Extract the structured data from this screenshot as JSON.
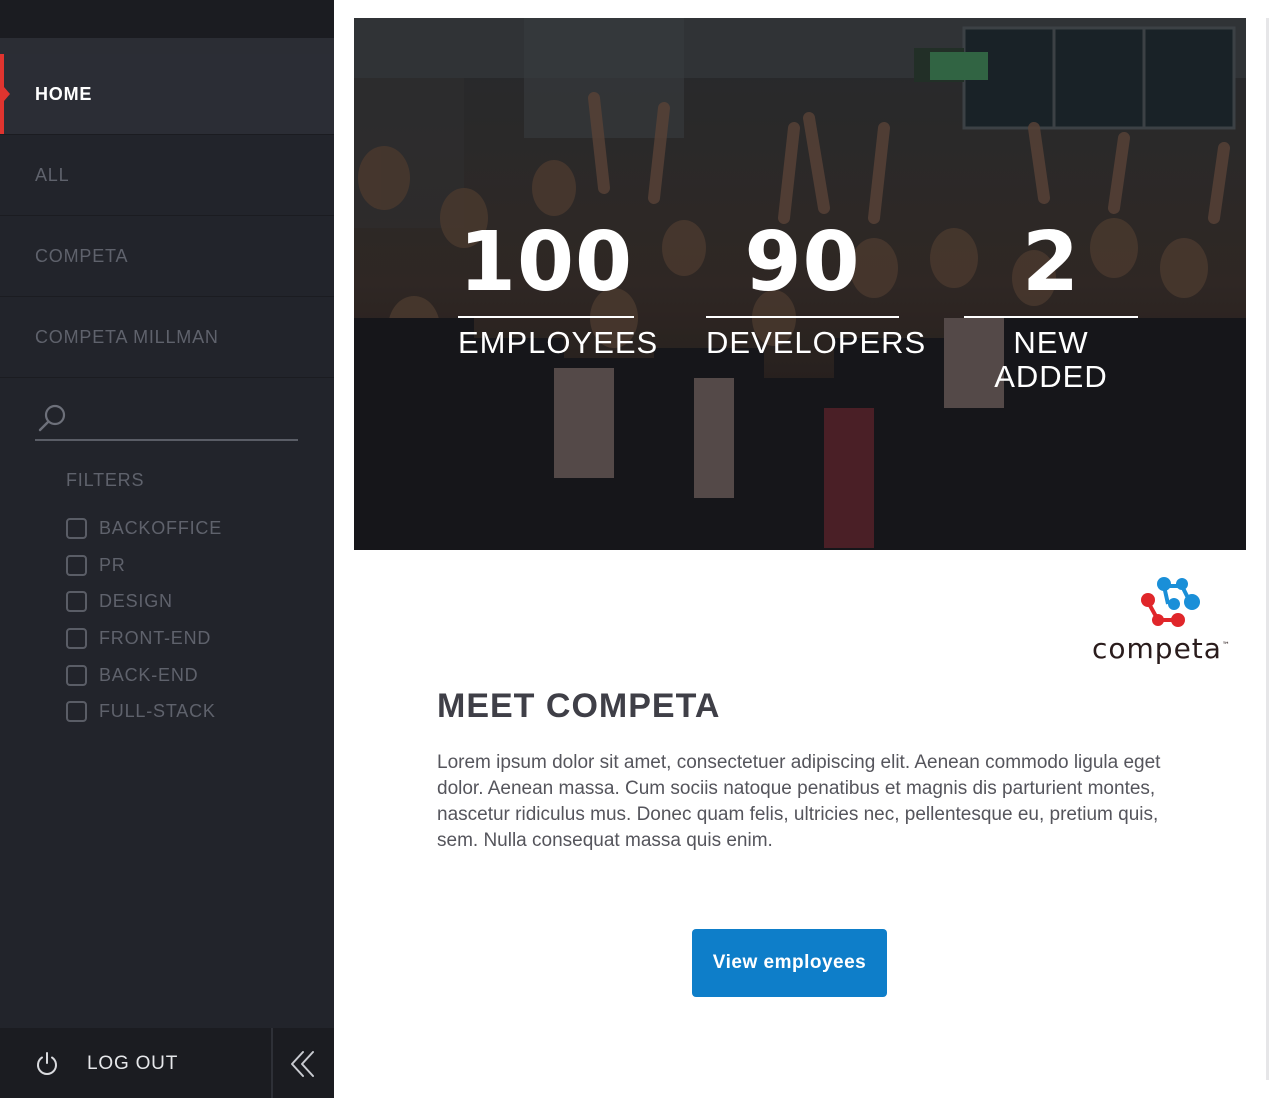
{
  "sidebar": {
    "nav": [
      {
        "label": "HOME",
        "active": true
      },
      {
        "label": "ALL",
        "active": false
      },
      {
        "label": "COMPETA",
        "active": false
      },
      {
        "label": "COMPETA MILLMAN",
        "active": false
      }
    ],
    "search": {
      "value": "",
      "placeholder": ""
    },
    "filters": {
      "title": "FILTERS",
      "items": [
        {
          "label": "BACKOFFICE",
          "checked": false
        },
        {
          "label": "PR",
          "checked": false
        },
        {
          "label": "DESIGN",
          "checked": false
        },
        {
          "label": "FRONT-END",
          "checked": false
        },
        {
          "label": "BACK-END",
          "checked": false
        },
        {
          "label": "FULL-STACK",
          "checked": false
        }
      ]
    },
    "logout_label": "LOG OUT"
  },
  "hero": {
    "stats": [
      {
        "value": "100",
        "label": "EMPLOYEES"
      },
      {
        "value": "90",
        "label": "DEVELOPERS"
      },
      {
        "value": "2",
        "label": "NEW ADDED"
      }
    ]
  },
  "brand": {
    "name": "competa",
    "trademark": "™"
  },
  "intro": {
    "title": "MEET COMPETA",
    "body": "Lorem ipsum dolor sit amet, consectetuer adipiscing elit. Aenean commodo ligula eget dolor. Aenean massa. Cum sociis natoque penatibus et magnis dis parturient montes, nascetur ridiculus mus. Donec quam felis, ultricies nec, pellentesque eu, pretium quis, sem. Nulla consequat massa quis enim."
  },
  "actions": {
    "view_employees": "View employees"
  },
  "colors": {
    "sidebar_bg": "#22242b",
    "active_accent": "#e0342f",
    "button_blue": "#0e7ec9",
    "logo_blue": "#1a8fd8",
    "logo_red": "#e0262a"
  }
}
